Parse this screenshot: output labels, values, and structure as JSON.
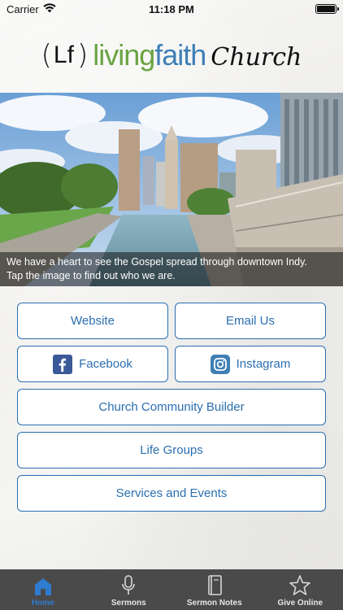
{
  "status_bar": {
    "carrier": "Carrier",
    "time": "11:18 PM",
    "battery_level": 1.0
  },
  "logo": {
    "paren_open": "(",
    "lf": "Lf",
    "paren_close": ")",
    "living": "living",
    "faith": "faith",
    "church": "Church",
    "colors": {
      "living": "#6aa342",
      "faith": "#3f7fb6"
    }
  },
  "hero": {
    "caption_line1": "We have a heart to see the Gospel spread through downtown Indy.",
    "caption_line2": "Tap the image to find out who we are."
  },
  "buttons": {
    "website": "Website",
    "email": "Email Us",
    "facebook": "Facebook",
    "instagram": "Instagram",
    "ccb": "Church Community Builder",
    "life_groups": "Life Groups",
    "services": "Services and Events"
  },
  "tabs": [
    {
      "label": "Home",
      "icon": "home-icon",
      "active": true
    },
    {
      "label": "Sermons",
      "icon": "microphone-icon",
      "active": false
    },
    {
      "label": "Sermon Notes",
      "icon": "book-icon",
      "active": false
    },
    {
      "label": "Give Online",
      "icon": "star-icon",
      "active": false
    }
  ],
  "colors": {
    "accent": "#2a6fb0",
    "tab_bar": "#4a4a4a",
    "tab_active": "#2e7bd0",
    "facebook": "#3b5998",
    "instagram": "#3f7fb6"
  }
}
